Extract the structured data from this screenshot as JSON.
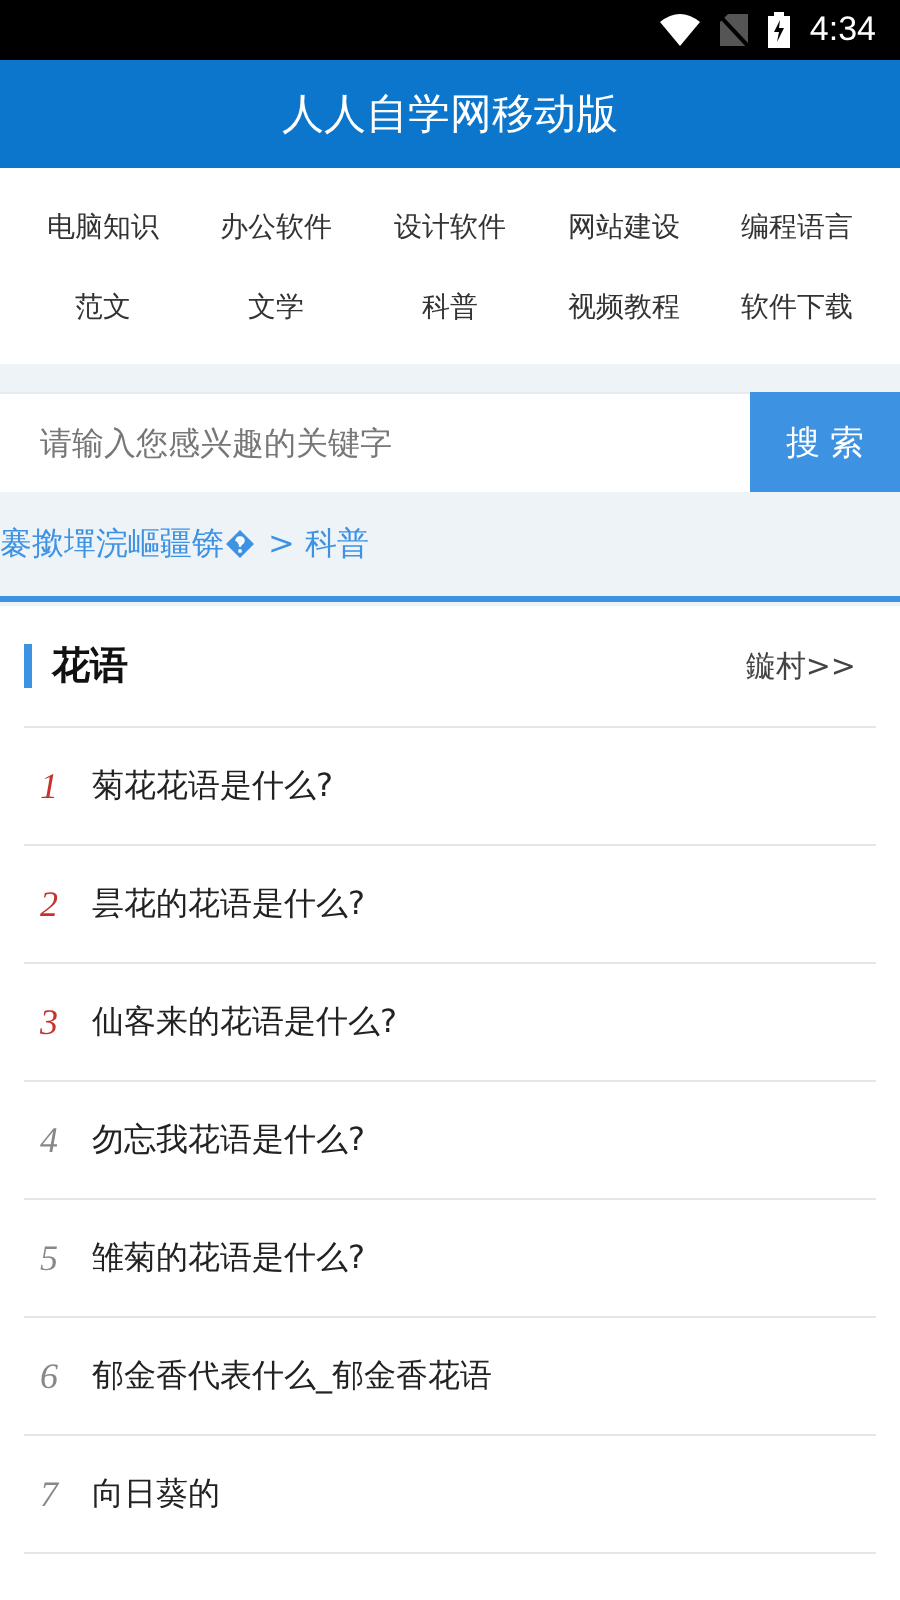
{
  "status_bar": {
    "time": "4:34"
  },
  "header": {
    "title": "人人自学网移动版"
  },
  "nav": [
    "电脑知识",
    "办公软件",
    "设计软件",
    "网站建设",
    "编程语言",
    "范文",
    "文学",
    "科普",
    "视频教程",
    "软件下载"
  ],
  "search": {
    "placeholder": "请输入您感兴趣的关键字",
    "button": "搜 索"
  },
  "breadcrumb": {
    "text": "褰撳墠浣嶇疆锛",
    "trail": "> 科普"
  },
  "section": {
    "title": "花语",
    "more": "鏇村>>",
    "items": [
      {
        "num": "1",
        "hot": true,
        "text": "菊花花语是什么?"
      },
      {
        "num": "2",
        "hot": true,
        "text": "昙花的花语是什么?"
      },
      {
        "num": "3",
        "hot": true,
        "text": "仙客来的花语是什么?"
      },
      {
        "num": "4",
        "hot": false,
        "text": "勿忘我花语是什么?"
      },
      {
        "num": "5",
        "hot": false,
        "text": "雏菊的花语是什么?"
      },
      {
        "num": "6",
        "hot": false,
        "text": "郁金香代表什么_郁金香花语"
      },
      {
        "num": "7",
        "hot": false,
        "text": "向日葵的"
      }
    ]
  }
}
